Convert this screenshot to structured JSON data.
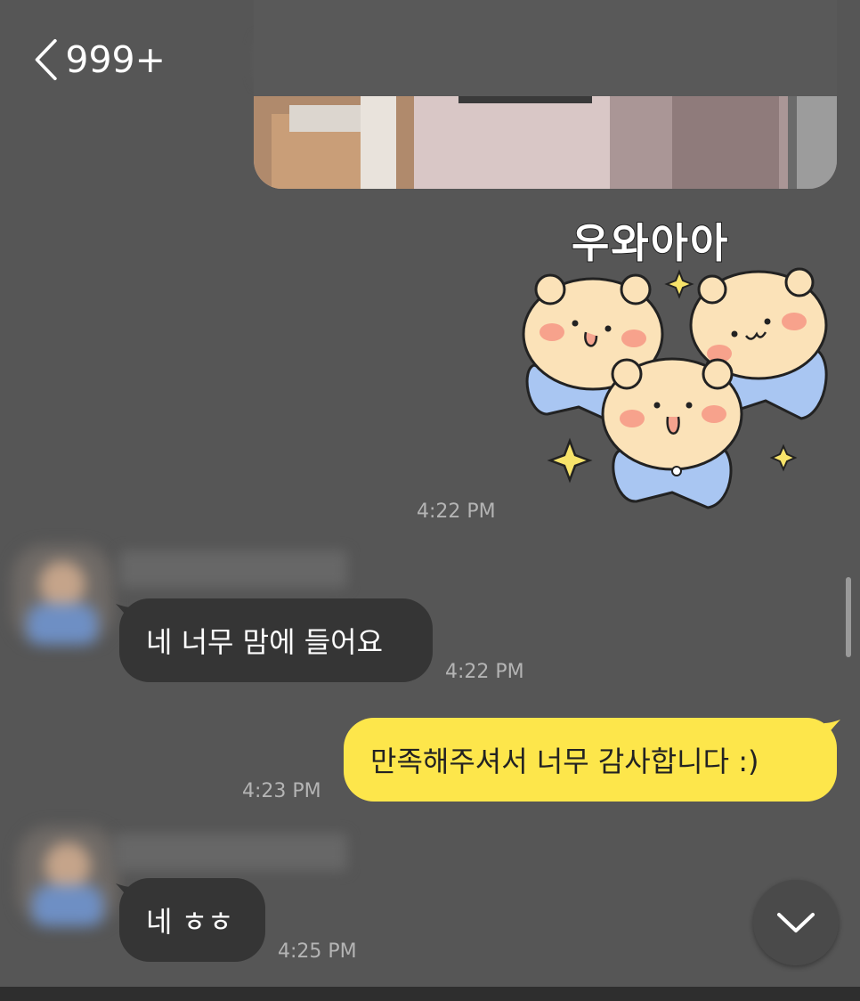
{
  "header": {
    "back_count": "999+"
  },
  "sticker": {
    "text": "우와아아"
  },
  "messages": [
    {
      "time": "4:22 PM"
    },
    {
      "text": "네 너무 맘에 들어요",
      "time": "4:22 PM"
    },
    {
      "text": "만족해주셔서 너무 감사합니다 :)",
      "time": "4:23 PM"
    },
    {
      "text": "네 ㅎㅎ",
      "time": "4:25 PM"
    }
  ],
  "colors": {
    "background": "#565656",
    "incoming_bubble": "#353535",
    "outgoing_bubble": "#fde64b",
    "timestamp": "#b4b4b4"
  }
}
